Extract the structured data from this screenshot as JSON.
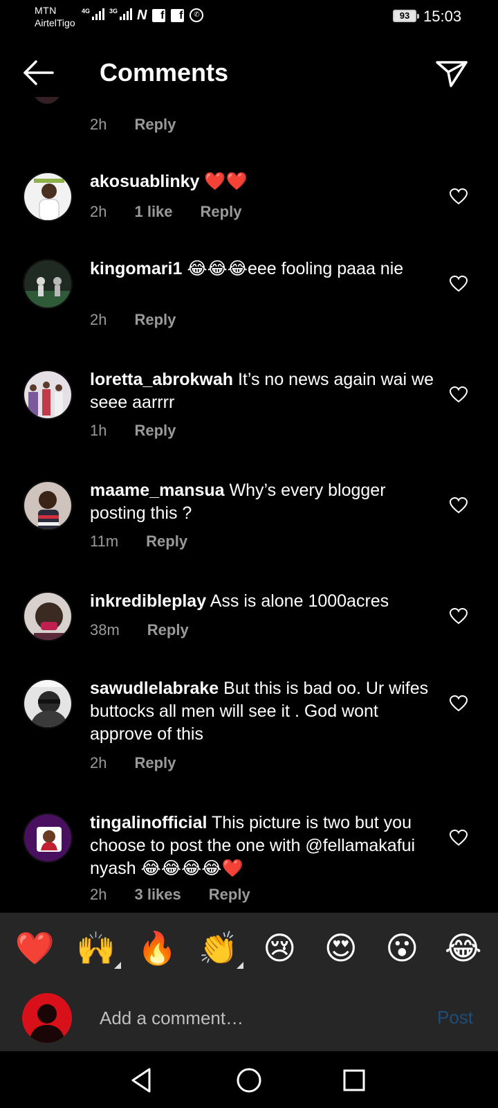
{
  "status_bar": {
    "carrier_1": "MTN",
    "carrier_2": "AirtelTigo",
    "sim1_label": "4G",
    "sim2_label": "3G",
    "battery": "93",
    "time": "15:03"
  },
  "header": {
    "title": "Comments"
  },
  "partial_comment": {
    "time": "2h",
    "reply": "Reply"
  },
  "comments": [
    {
      "username": "akosuablinky",
      "text": "❤️❤️",
      "time": "2h",
      "likes": "1 like",
      "reply": "Reply",
      "avatar_color": "#e8e8e8"
    },
    {
      "username": "kingomari1",
      "text": "😂😂😂eee fooling paaa nie",
      "time": "2h",
      "reply": "Reply",
      "avatar_color": "#2a3a2a"
    },
    {
      "username": "loretta_abrokwah",
      "text": "It’s no news again wai we seee aarrrr",
      "time": "1h",
      "reply": "Reply",
      "avatar_color": "#c9c3c9"
    },
    {
      "username": "maame_mansua",
      "text": "Why’s every blogger posting this ?",
      "time": "11m",
      "reply": "Reply",
      "avatar_color": "#6b4a3a"
    },
    {
      "username": "inkredibleplay",
      "text": "Ass is alone 1000acres",
      "time": "38m",
      "reply": "Reply",
      "avatar_color": "#3a2a2e"
    },
    {
      "username": "sawudlelabrake",
      "text": "But this is bad oo. Ur wifes buttocks all men will see it . God wont approve of this",
      "time": "2h",
      "reply": "Reply",
      "avatar_color": "#8a8a8a"
    },
    {
      "username": "tingalinofficial",
      "text": "This picture is two but you choose to post the one with @fellamakafui nyash 😂😂😂😂❤️",
      "time": "2h",
      "likes": "3 likes",
      "reply": "Reply",
      "avatar_color": "#5a1a7a"
    }
  ],
  "reactions": [
    "❤️",
    "🙌",
    "🔥",
    "👏",
    "😢",
    "😍",
    "😮",
    "😂"
  ],
  "compose": {
    "placeholder": "Add a comment…",
    "post_label": "Post"
  },
  "colors": {
    "background": "#000000",
    "panel": "#262626",
    "meta_text": "#9a9a9a",
    "post_disabled": "#1e4d7a"
  }
}
